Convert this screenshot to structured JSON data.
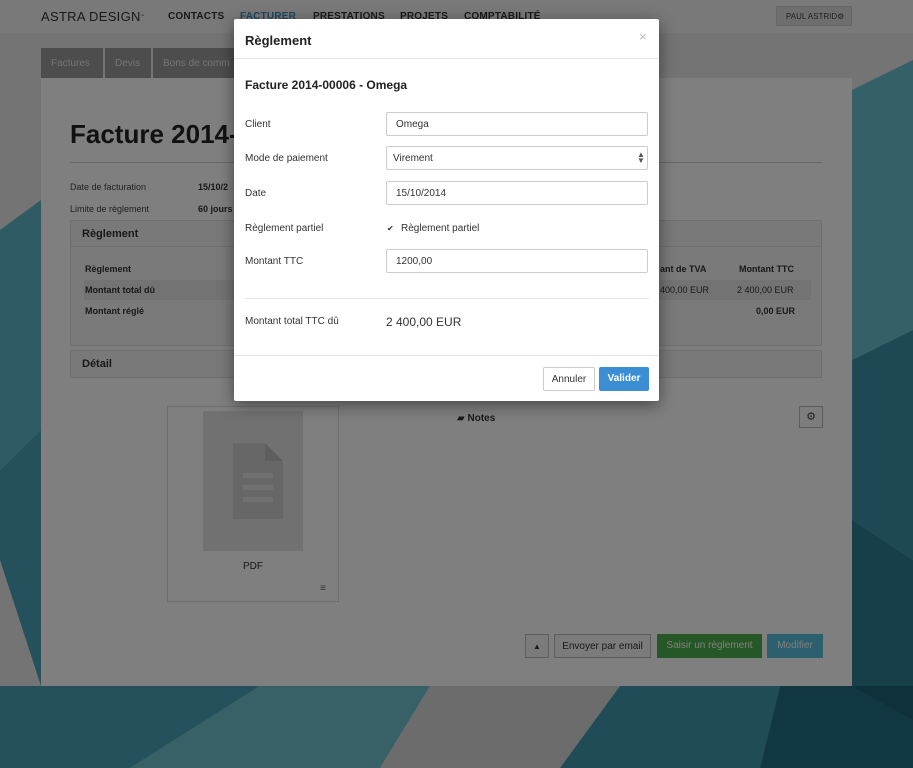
{
  "colors": {
    "accent": "#3a8fc8",
    "primary_button": "#3b8ed4",
    "success_button": "#4cae4c",
    "info_button": "#5bc0de"
  },
  "nav": {
    "brand": "ASTRA DESIGN",
    "brand_caret": "-",
    "links": [
      "CONTACTS",
      "FACTURER",
      "PRESTATIONS",
      "PROJETS",
      "COMPTABILITÉ"
    ],
    "active": "FACTURER",
    "user": "PAUL ASTRID"
  },
  "subtabs": [
    "Factures",
    "Devis",
    "Bons de comm"
  ],
  "page": {
    "title": "Facture 2014-",
    "date_label": "Date de facturation",
    "date_value": "15/10/2",
    "limit_label": "Limite de règlement",
    "limit_value": "60 jours",
    "reglement_section": "Règlement",
    "table": {
      "col_reglement": "Règlement",
      "col_tva": "ant de TVA",
      "col_ttc": "Montant TTC",
      "row_due_label": "Montant total dû",
      "row_due_tva": "400,00 EUR",
      "row_due_ttc": "2 400,00 EUR",
      "row_paid_label": "Montant réglé",
      "row_paid_ttc": "0,00 EUR"
    },
    "detail_section": "Détail",
    "pdf_label": "PDF",
    "notes_label": "Notes",
    "actions": {
      "toggle": "▲",
      "email": "Envoyer par email",
      "payment": "Saisir un règlement",
      "edit": "Modifier"
    }
  },
  "modal": {
    "title": "Règlement",
    "close": "×",
    "subtitle": "Facture 2014-00006 - Omega",
    "fields": {
      "client_label": "Client",
      "client_value": "Omega",
      "mode_label": "Mode de paiement",
      "mode_value": "Virement",
      "date_label": "Date",
      "date_value": "15/10/2014",
      "partial_label": "Règlement partiel",
      "partial_check_label": "Règlement partiel",
      "amount_label": "Montant TTC",
      "amount_value": "1200,00"
    },
    "total_label": "Montant total TTC dû",
    "total_value": "2 400,00 EUR",
    "cancel": "Annuler",
    "ok": "Valider"
  }
}
